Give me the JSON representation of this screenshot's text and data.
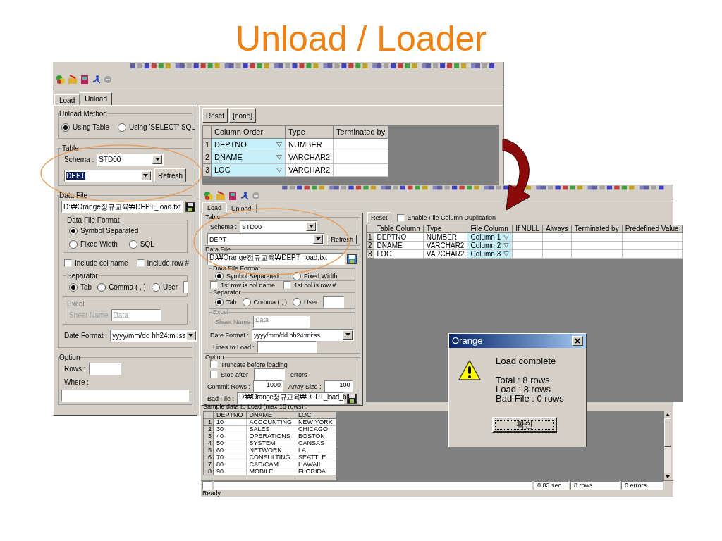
{
  "slide_title": "Unload / Loader",
  "unload_window": {
    "tabs": [
      {
        "label": "Load",
        "selected": false
      },
      {
        "label": "Unload",
        "selected": true
      }
    ],
    "unload_method": {
      "legend": "Unload Method",
      "options": [
        {
          "label": "Using Table",
          "selected": true
        },
        {
          "label": "Using 'SELECT' SQL",
          "selected": false
        }
      ]
    },
    "table_group": {
      "legend": "Table",
      "schema_label": "Schema :",
      "schema": "STD00",
      "table": "DEPT",
      "table_text_selected": true,
      "refresh": "Refresh"
    },
    "data_file": {
      "legend": "Data File",
      "path": "D:₩Orange정규교육₩DEPT_load.txt"
    },
    "file_format": {
      "legend": "Data File Format",
      "options": [
        {
          "label": "Symbol Separated",
          "selected": true
        },
        {
          "label": "Fixed Width",
          "selected": false
        },
        {
          "label": "SQL",
          "selected": false
        }
      ]
    },
    "checkboxes": [
      {
        "label": "Include col name",
        "checked": false
      },
      {
        "label": "Include row #",
        "checked": false
      }
    ],
    "separator": {
      "legend": "Separator",
      "options": [
        {
          "label": "Tab",
          "selected": true
        },
        {
          "label": "Comma ( , )",
          "selected": false
        },
        {
          "label": "User",
          "selected": false
        }
      ]
    },
    "excel": {
      "legend": "Excel",
      "sheet_label": "Sheet Name",
      "sheet": "Data",
      "disabled": true
    },
    "date_format": {
      "label": "Date Format :",
      "value": "yyyy/mm/dd hh24:mi:ss"
    },
    "option": {
      "legend": "Option",
      "rows_label": "Rows :",
      "where_label": "Where :"
    },
    "buttons": [
      "Reset",
      "[none]"
    ],
    "grid": {
      "columns": [
        "Column Order",
        "Type",
        "Terminated by"
      ],
      "rows": [
        {
          "number": "1",
          "column": "DEPTNO",
          "type": "NUMBER"
        },
        {
          "number": "2",
          "column": "DNAME",
          "type": "VARCHAR2"
        },
        {
          "number": "3",
          "column": "LOC",
          "type": "VARCHAR2"
        }
      ]
    }
  },
  "load_window": {
    "tabs": [
      {
        "label": "Load",
        "selected": true
      },
      {
        "label": "Unload",
        "selected": false
      }
    ],
    "table_group": {
      "legend": "Table",
      "schema_label": "Schema :",
      "schema": "STD00",
      "table": "DEPT",
      "table_text_selected": false,
      "refresh": "Refresh"
    },
    "data_file": {
      "legend": "Data File",
      "path": "D:₩Orange정규교육₩DEPT_load.txt"
    },
    "file_format": {
      "legend": "Data File Format",
      "options": [
        {
          "label": "Symbol Separated",
          "selected": true
        },
        {
          "label": "Fixed Width",
          "selected": false
        }
      ]
    },
    "checkboxes": [
      {
        "label": "1st row is col name",
        "checked": false
      },
      {
        "label": "1st col is row #",
        "checked": false
      }
    ],
    "separator": {
      "legend": "Separator",
      "options": [
        {
          "label": "Tab",
          "selected": true
        },
        {
          "label": "Comma ( , )",
          "selected": false
        },
        {
          "label": "User",
          "selected": false
        }
      ]
    },
    "excel": {
      "legend": "Excel",
      "sheet_label": "Sheet Name",
      "sheet": "Data",
      "disabled": true
    },
    "date_format": {
      "label": "Date Format :",
      "value": "yyyy/mm/dd hh24:mi:ss"
    },
    "lines_label": "Lines to Load :",
    "option": {
      "legend": "Option",
      "checkboxes": [
        {
          "label": "Truncate before loading",
          "checked": false
        },
        {
          "label": "Stop after",
          "checked": false
        }
      ],
      "errors_label": "errors",
      "commit_label": "Commit Rows :",
      "commit": "1000",
      "array_label": "Array Size :",
      "array": "100",
      "bad_file_label": "Bad File :",
      "bad_file": "D:₩Orange정규교육₩DEPT_load_b"
    },
    "reset": "Reset",
    "duplication": {
      "label": "Enable File Column Duplication",
      "checked": false
    },
    "grid": {
      "columns": [
        "Table Column",
        "Type",
        "File Column",
        "If NULL",
        "Always",
        "Terminated by",
        "Predefined Value"
      ],
      "rows": [
        {
          "number": "1",
          "table_column": "DEPTNO",
          "type": "NUMBER",
          "file_column": "Column 1"
        },
        {
          "number": "2",
          "table_column": "DNAME",
          "type": "VARCHAR2",
          "file_column": "Column 2"
        },
        {
          "number": "3",
          "table_column": "LOC",
          "type": "VARCHAR2",
          "file_column": "Column 3"
        }
      ]
    },
    "sample": {
      "caption": "Sample data to Load (max 15 rows) :",
      "columns": [
        "DEPTNO",
        "DNAME",
        "LOC"
      ],
      "rows": [
        {
          "number": "1",
          "cells": [
            "10",
            "ACCOUNTING",
            "NEW YORK"
          ]
        },
        {
          "number": "2",
          "cells": [
            "30",
            "SALES",
            "CHICAGO"
          ]
        },
        {
          "number": "3",
          "cells": [
            "40",
            "OPERATIONS",
            "BOSTON"
          ]
        },
        {
          "number": "4",
          "cells": [
            "50",
            "SYSTEM",
            "CANSAS"
          ]
        },
        {
          "number": "5",
          "cells": [
            "60",
            "NETWORK",
            "LA"
          ]
        },
        {
          "number": "6",
          "cells": [
            "70",
            "CONSULTING",
            "SEATTLE"
          ]
        },
        {
          "number": "7",
          "cells": [
            "80",
            "CAD/CAM",
            "HAWAII"
          ]
        },
        {
          "number": "8",
          "cells": [
            "90",
            "MOBILE",
            "FLORIDA"
          ]
        }
      ]
    },
    "status_bar": {
      "cells": [
        "0.03 sec.",
        "8 rows",
        "0 errors"
      ],
      "message": "Ready"
    }
  },
  "dialog": {
    "title": "Orange",
    "heading": "Load complete",
    "lines": [
      "Total : 8 rows",
      "Load : 8 rows",
      "Bad File : 0 rows"
    ],
    "button": "확인"
  }
}
